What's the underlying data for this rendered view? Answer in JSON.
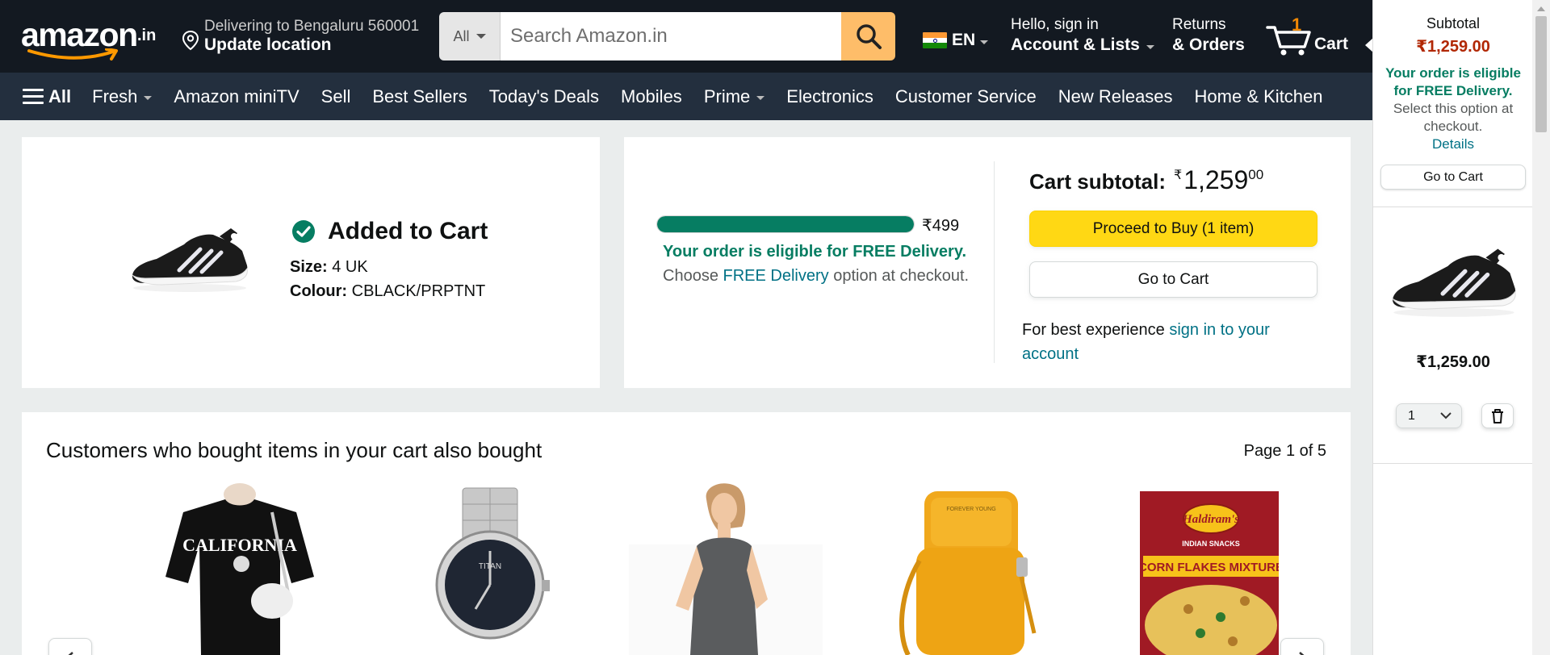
{
  "header": {
    "logo_text": "amazon",
    "logo_suffix": ".in",
    "deliver_line1": "Delivering to Bengaluru 560001",
    "deliver_line2": "Update location",
    "search_category": "All",
    "search_placeholder": "Search Amazon.in",
    "language": "EN",
    "account_line1": "Hello, sign in",
    "account_line2": "Account & Lists",
    "returns_line1": "Returns",
    "returns_line2": "& Orders",
    "cart_count": "1",
    "cart_label": "Cart"
  },
  "nav": {
    "all_label": "All",
    "links": [
      "Fresh",
      "Amazon miniTV",
      "Sell",
      "Best Sellers",
      "Today's Deals",
      "Mobiles",
      "Prime",
      "Electronics",
      "Customer Service",
      "New Releases",
      "Home & Kitchen"
    ]
  },
  "added": {
    "title": "Added to Cart",
    "size_label": "Size:",
    "size_value": "4 UK",
    "colour_label": "Colour:",
    "colour_value": "CBLACK/PRPTNT"
  },
  "subtotal_card": {
    "progress_fraction": 1.0,
    "progress_amount": "₹499",
    "free_bold": "Your order is eligible for FREE Delivery.",
    "free_pre": "Choose",
    "free_link": "FREE Delivery",
    "free_post": "option at checkout.",
    "subtotal_label": "Cart subtotal:",
    "subtotal_symbol": "₹",
    "subtotal_whole": "1,259",
    "subtotal_fraction": "00",
    "proceed_label": "Proceed to Buy (1 item)",
    "go_to_cart_label": "Go to Cart",
    "best_exp_pre": "For best experience",
    "best_exp_link": "sign in to your account"
  },
  "recommendations": {
    "title": "Customers who bought items in your cart also bought",
    "page_prefix": "Page",
    "page_current": "1",
    "page_of": "of",
    "page_total": "5",
    "items": [
      "t-shirt",
      "watch",
      "dress",
      "bag",
      "snack"
    ],
    "shirt_text": "CALIFORNIA",
    "watch_brand": "TITAN",
    "bag_brand": "FOREVER YOUNG",
    "snack_brand": "Haldiram's",
    "snack_name": "CORN FLAKES MIXTURE",
    "snack_sub": "INDIAN SNACKS"
  },
  "sidebar": {
    "subtotal_label": "Subtotal",
    "subtotal_value": "₹1,259.00",
    "msg_bold": "Your order is eligible for FREE Delivery.",
    "msg_rest": "Select this option at checkout.",
    "details_link": "Details",
    "go_to_cart_label": "Go to Cart",
    "item_price": "₹1,259.00",
    "qty_value": "1"
  },
  "colors": {
    "nav_top": "#131921",
    "nav_bottom": "#232f3e",
    "accent_orange": "#febd69",
    "price_red": "#b12704",
    "success_green": "#067d62",
    "link_teal": "#007185",
    "button_yellow": "#ffd814"
  }
}
